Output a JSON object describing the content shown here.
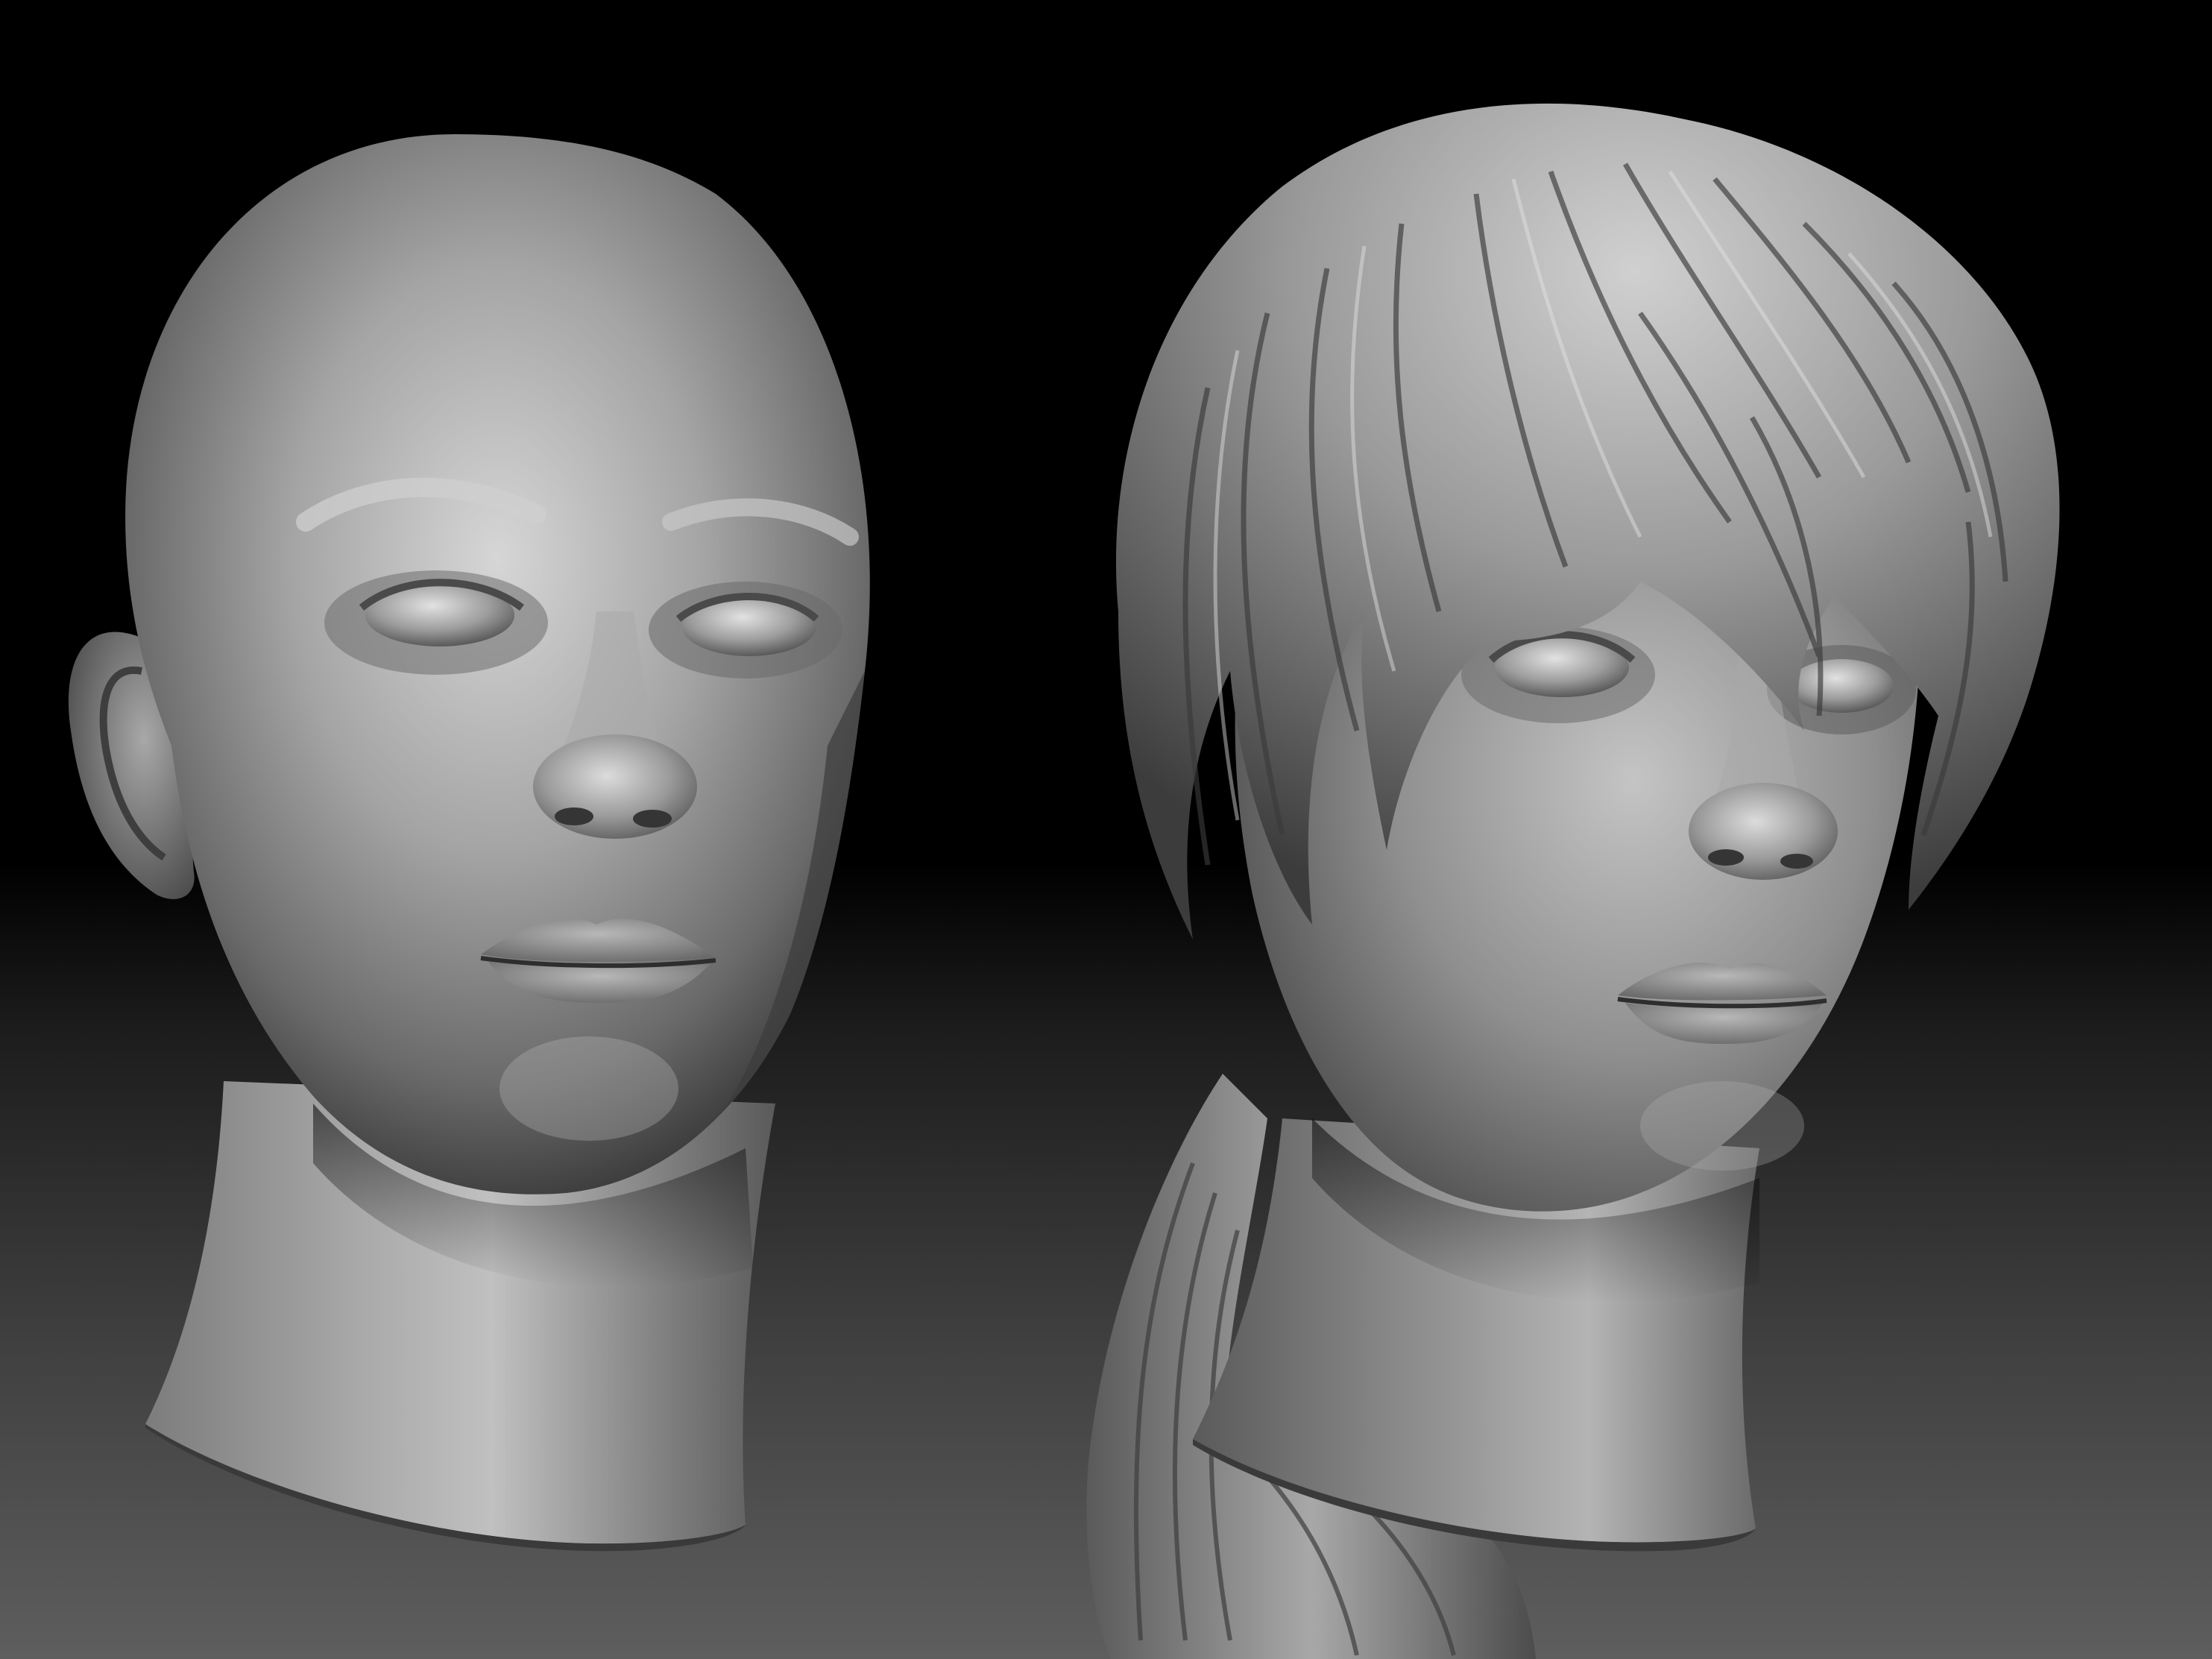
{
  "scene": {
    "background_colors": [
      "#000000",
      "#1a1a1a",
      "#4a4a4a",
      "#5c5c5c"
    ],
    "material_color": "#8c8c8c",
    "objects": [
      {
        "name": "bald-head-sculpt"
      },
      {
        "name": "haired-head-sculpt"
      }
    ]
  }
}
